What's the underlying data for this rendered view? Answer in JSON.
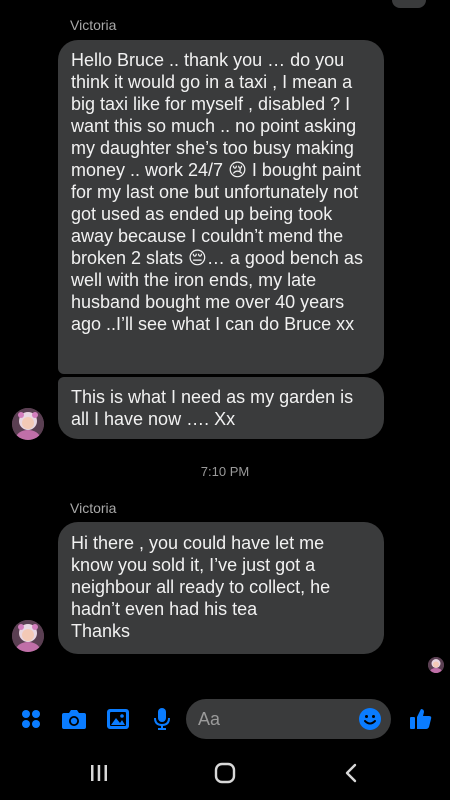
{
  "messages": [
    {
      "sender": "Victoria",
      "text": "Hello Bruce .. thank you … do you think it would go in a taxi , I mean a big taxi like for myself , disabled ? I want this so much .. no point asking my daughter she’s too busy making money .. work 24/7 😢 I bought paint for my last one but unfortunately not got used as ended up being took away because I couldn’t mend the broken 2 slats 😔… a good bench as well with the iron ends, my late husband bought me over 40 years ago ..I’ll see what I can do Bruce xx"
    },
    {
      "text": "This is what I need as my garden is all I have now …. Xx"
    },
    {
      "sender": "Victoria",
      "text": "Hi there , you could have let me know you sold it, I’ve just got a neighbour all ready to collect, he hadn’t even had his tea\nThanks"
    }
  ],
  "timestamp": "7:10 PM",
  "composer": {
    "placeholder": "Aa",
    "accent": "#0a7cff",
    "icons": [
      "apps-icon",
      "camera-icon",
      "gallery-icon",
      "microphone-icon",
      "emoji-icon",
      "thumbs-up-icon"
    ]
  },
  "nav": {
    "icons": [
      "recent-apps-icon",
      "home-icon",
      "back-icon"
    ]
  }
}
